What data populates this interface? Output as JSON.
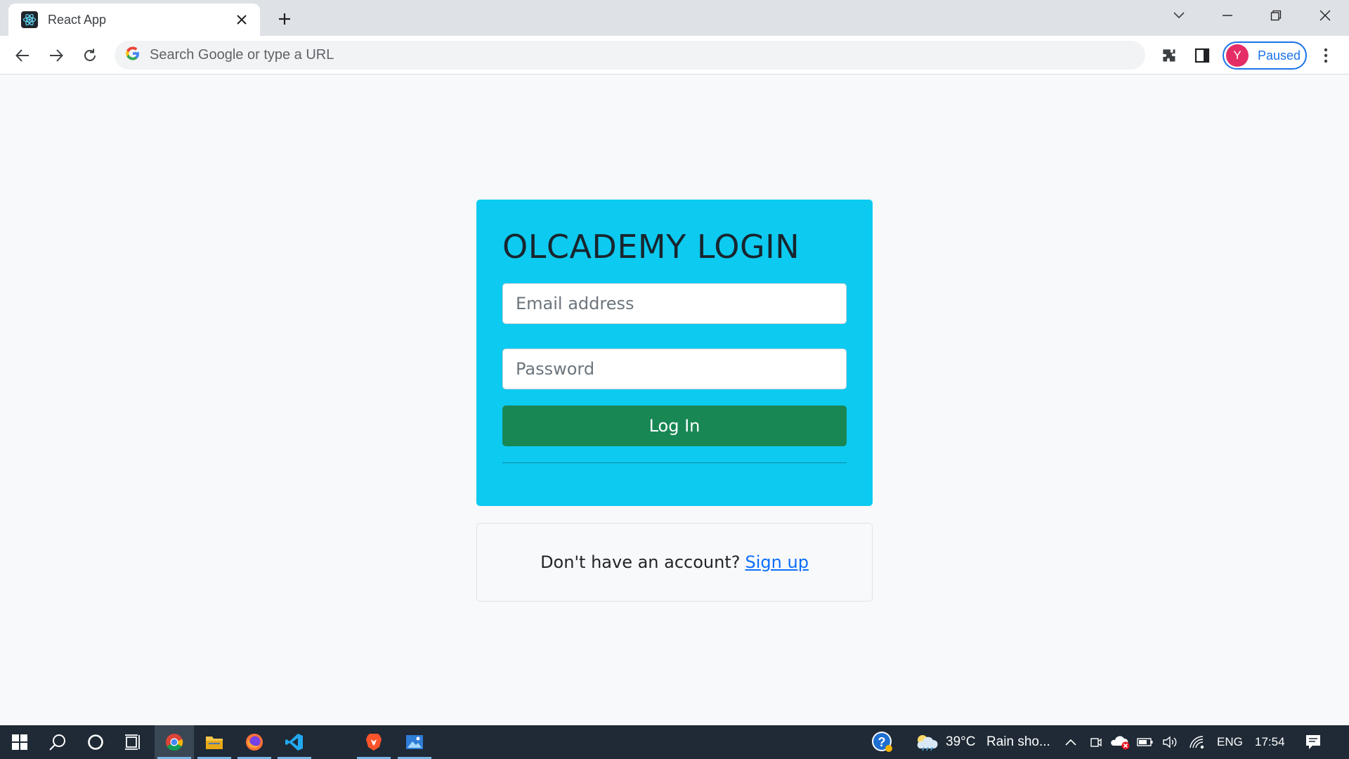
{
  "browser": {
    "tab": {
      "title": "React App",
      "favicon": "react-icon"
    },
    "omnibox": {
      "placeholder": "Search Google or type a URL"
    },
    "profile": {
      "initial": "Y",
      "status": "Paused"
    }
  },
  "login": {
    "title": "OLCADEMY LOGIN",
    "email_placeholder": "Email address",
    "password_placeholder": "Password",
    "submit_label": "Log In"
  },
  "signup": {
    "prompt": "Don't have an account?",
    "link": "Sign up"
  },
  "taskbar": {
    "weather": {
      "temp": "39°C",
      "condition": "Rain sho..."
    },
    "language": "ENG",
    "time": "17:54"
  },
  "colors": {
    "card_bg": "#0dcaf0",
    "button_bg": "#198754",
    "link": "#0d6efd",
    "avatar": "#e52d65"
  }
}
